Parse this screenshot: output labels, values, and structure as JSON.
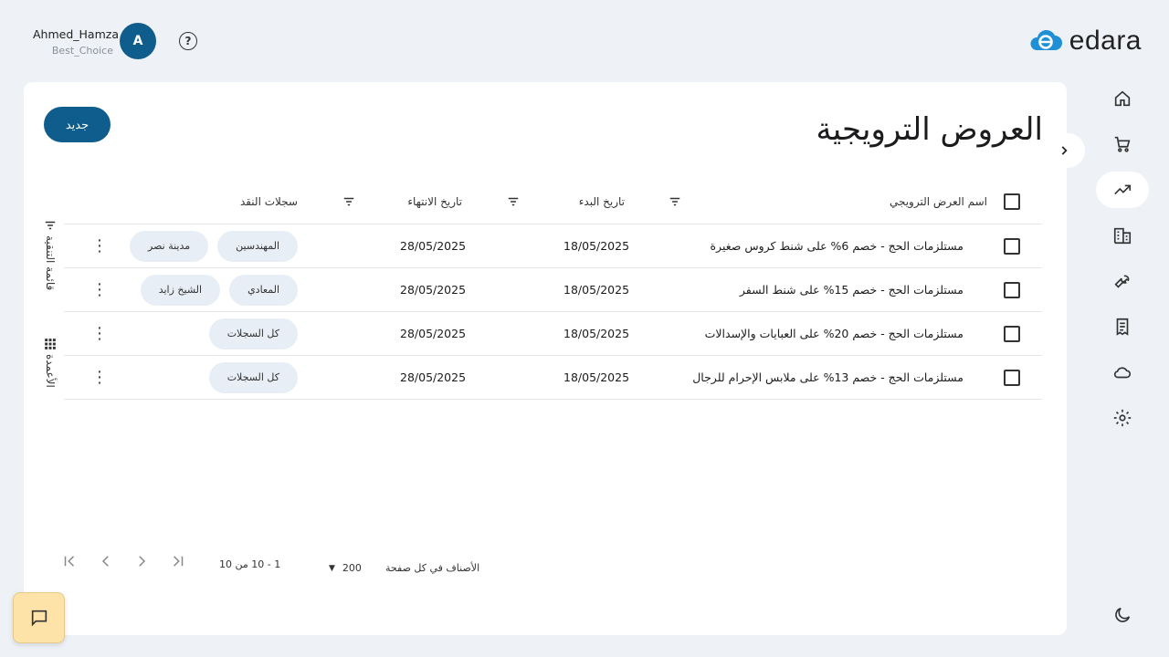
{
  "header": {
    "user_name": "Ahmed_Hamza",
    "company": "Best_Choice",
    "avatar_letter": "A",
    "logo_text": "edara"
  },
  "sidebar": {
    "items": [
      {
        "name": "home-icon",
        "active": false
      },
      {
        "name": "cart-icon",
        "active": false
      },
      {
        "name": "trending-icon",
        "active": true
      },
      {
        "name": "building-icon",
        "active": false
      },
      {
        "name": "wrench-icon",
        "active": false
      },
      {
        "name": "receipt-icon",
        "active": false
      },
      {
        "name": "cloud-icon",
        "active": false
      },
      {
        "name": "gear-icon",
        "active": false
      }
    ],
    "theme_icon": "moon-icon"
  },
  "page": {
    "title": "العروض الترويجية",
    "new_button": "جديد"
  },
  "side_tools": {
    "filter_label": "قائمة التنقية",
    "columns_label": "الأعمدة"
  },
  "table": {
    "headers": {
      "name": "اسم العرض الترويجي",
      "start": "تاريخ البدء",
      "end": "تاريخ الانتهاء",
      "registers": "سجلات النقد"
    },
    "rows": [
      {
        "name": "مستلزمات الحج - خصم 6% على شنط كروس صغيرة",
        "start": "18/05/2025",
        "end": "28/05/2025",
        "chips": [
          "المهندسين",
          "مدينة نصر"
        ]
      },
      {
        "name": "مستلزمات الحج - خصم 15% على شنط السفر",
        "start": "18/05/2025",
        "end": "28/05/2025",
        "chips": [
          "المعادي",
          "الشيخ زايد"
        ]
      },
      {
        "name": "مستلزمات الحج - خصم 20% على العبايات والإسدالات",
        "start": "18/05/2025",
        "end": "28/05/2025",
        "chips": [
          "كل السجلات"
        ]
      },
      {
        "name": "مستلزمات الحج - خصم 13% على ملابس الإحرام للرجال",
        "start": "18/05/2025",
        "end": "28/05/2025",
        "chips": [
          "كل السجلات"
        ]
      }
    ]
  },
  "pagination": {
    "per_page_label": "الأصناف في كل صفحة",
    "per_page_value": "200",
    "range": "1 - 10 من 10"
  },
  "colors": {
    "primary": "#0f5d8c",
    "chip_bg": "#e7eef6",
    "chat_bg": "#fde3a7"
  }
}
